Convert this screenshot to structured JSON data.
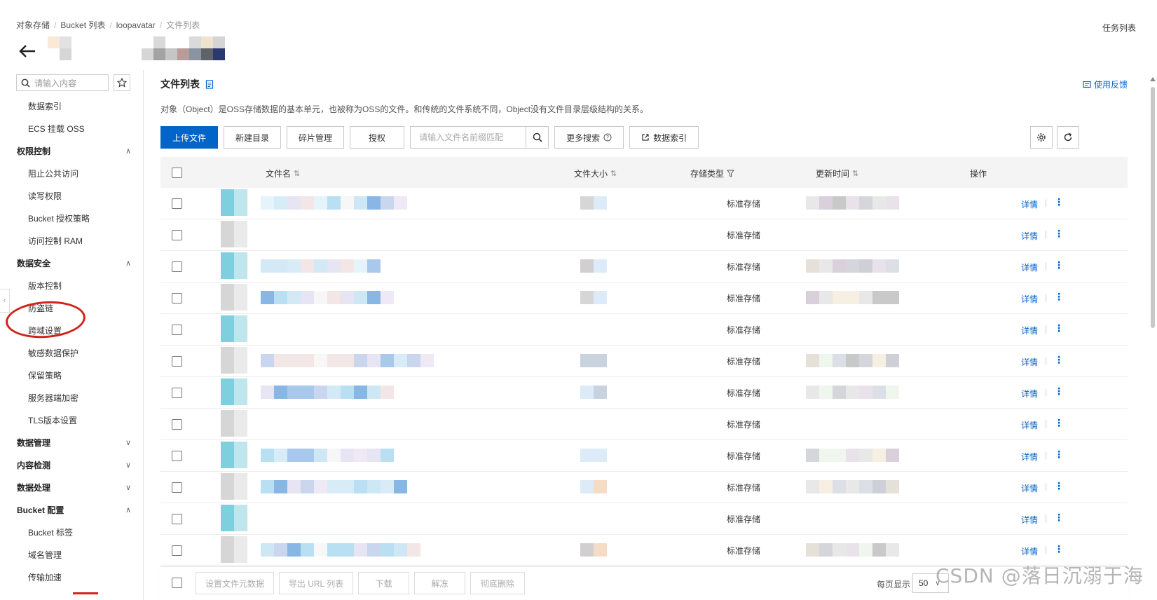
{
  "breadcrumb": [
    "对象存储",
    "Bucket 列表",
    "loopavatar",
    "文件列表"
  ],
  "header": {
    "task_list": "任务列表"
  },
  "sidebar": {
    "search_placeholder": "请输入内容",
    "items": [
      {
        "type": "item",
        "label": "数据索引"
      },
      {
        "type": "item",
        "label": "ECS 挂载 OSS"
      },
      {
        "type": "group",
        "label": "权限控制",
        "expanded": true
      },
      {
        "type": "item",
        "label": "阻止公共访问"
      },
      {
        "type": "item",
        "label": "读写权限"
      },
      {
        "type": "item",
        "label": "Bucket 授权策略"
      },
      {
        "type": "item",
        "label": "访问控制 RAM"
      },
      {
        "type": "group",
        "label": "数据安全",
        "expanded": true
      },
      {
        "type": "item",
        "label": "版本控制"
      },
      {
        "type": "item",
        "label": "防盗链"
      },
      {
        "type": "item",
        "label": "跨域设置",
        "highlighted": true
      },
      {
        "type": "item",
        "label": "敏感数据保护"
      },
      {
        "type": "item",
        "label": "保留策略"
      },
      {
        "type": "item",
        "label": "服务器端加密"
      },
      {
        "type": "item",
        "label": "TLS版本设置"
      },
      {
        "type": "group",
        "label": "数据管理",
        "expanded": false
      },
      {
        "type": "group",
        "label": "内容检测",
        "expanded": false
      },
      {
        "type": "group",
        "label": "数据处理",
        "expanded": false
      },
      {
        "type": "group",
        "label": "Bucket 配置",
        "expanded": true
      },
      {
        "type": "item",
        "label": "Bucket 标签"
      },
      {
        "type": "item",
        "label": "域名管理"
      },
      {
        "type": "item",
        "label": "传输加速"
      }
    ]
  },
  "main": {
    "title": "文件列表",
    "feedback": "使用反馈",
    "description": "对象（Object）是OSS存储数据的基本单元，也被称为OSS的文件。和传统的文件系统不同，Object没有文件目录层级结构的关系。",
    "toolbar": {
      "upload": "上传文件",
      "new_dir": "新建目录",
      "fragments": "碎片管理",
      "authorize": "授权",
      "search_placeholder": "请输入文件名前缀匹配",
      "more_search": "更多搜索",
      "data_index": "数据索引"
    },
    "table": {
      "columns": {
        "name": "文件名",
        "size": "文件大小",
        "storage": "存储类型",
        "updated": "更新时间",
        "actions": "操作"
      },
      "rows": [
        {
          "storage": "标准存储",
          "detail": "详情"
        },
        {
          "storage": "标准存储",
          "detail": "详情"
        },
        {
          "storage": "标准存储",
          "detail": "详情"
        },
        {
          "storage": "标准存储",
          "detail": "详情"
        },
        {
          "storage": "标准存储",
          "detail": "详情"
        },
        {
          "storage": "标准存储",
          "detail": "详情"
        },
        {
          "storage": "标准存储",
          "detail": "详情"
        },
        {
          "storage": "标准存储",
          "detail": "详情"
        },
        {
          "storage": "标准存储",
          "detail": "详情"
        },
        {
          "storage": "标准存储",
          "detail": "详情"
        },
        {
          "storage": "标准存储",
          "detail": "详情"
        },
        {
          "storage": "标准存储",
          "detail": "详情"
        }
      ]
    },
    "footer": {
      "set_meta": "设置文件元数据",
      "export_url": "导出 URL 列表",
      "download": "下载",
      "unfreeze": "解冻",
      "delete": "彻底删除",
      "per_page_label": "每页显示",
      "per_page_value": "50"
    }
  },
  "watermark": "CSDN @落日沉溺于海",
  "colors": {
    "primary": "#0064c8",
    "annotation": "#d0231b"
  }
}
